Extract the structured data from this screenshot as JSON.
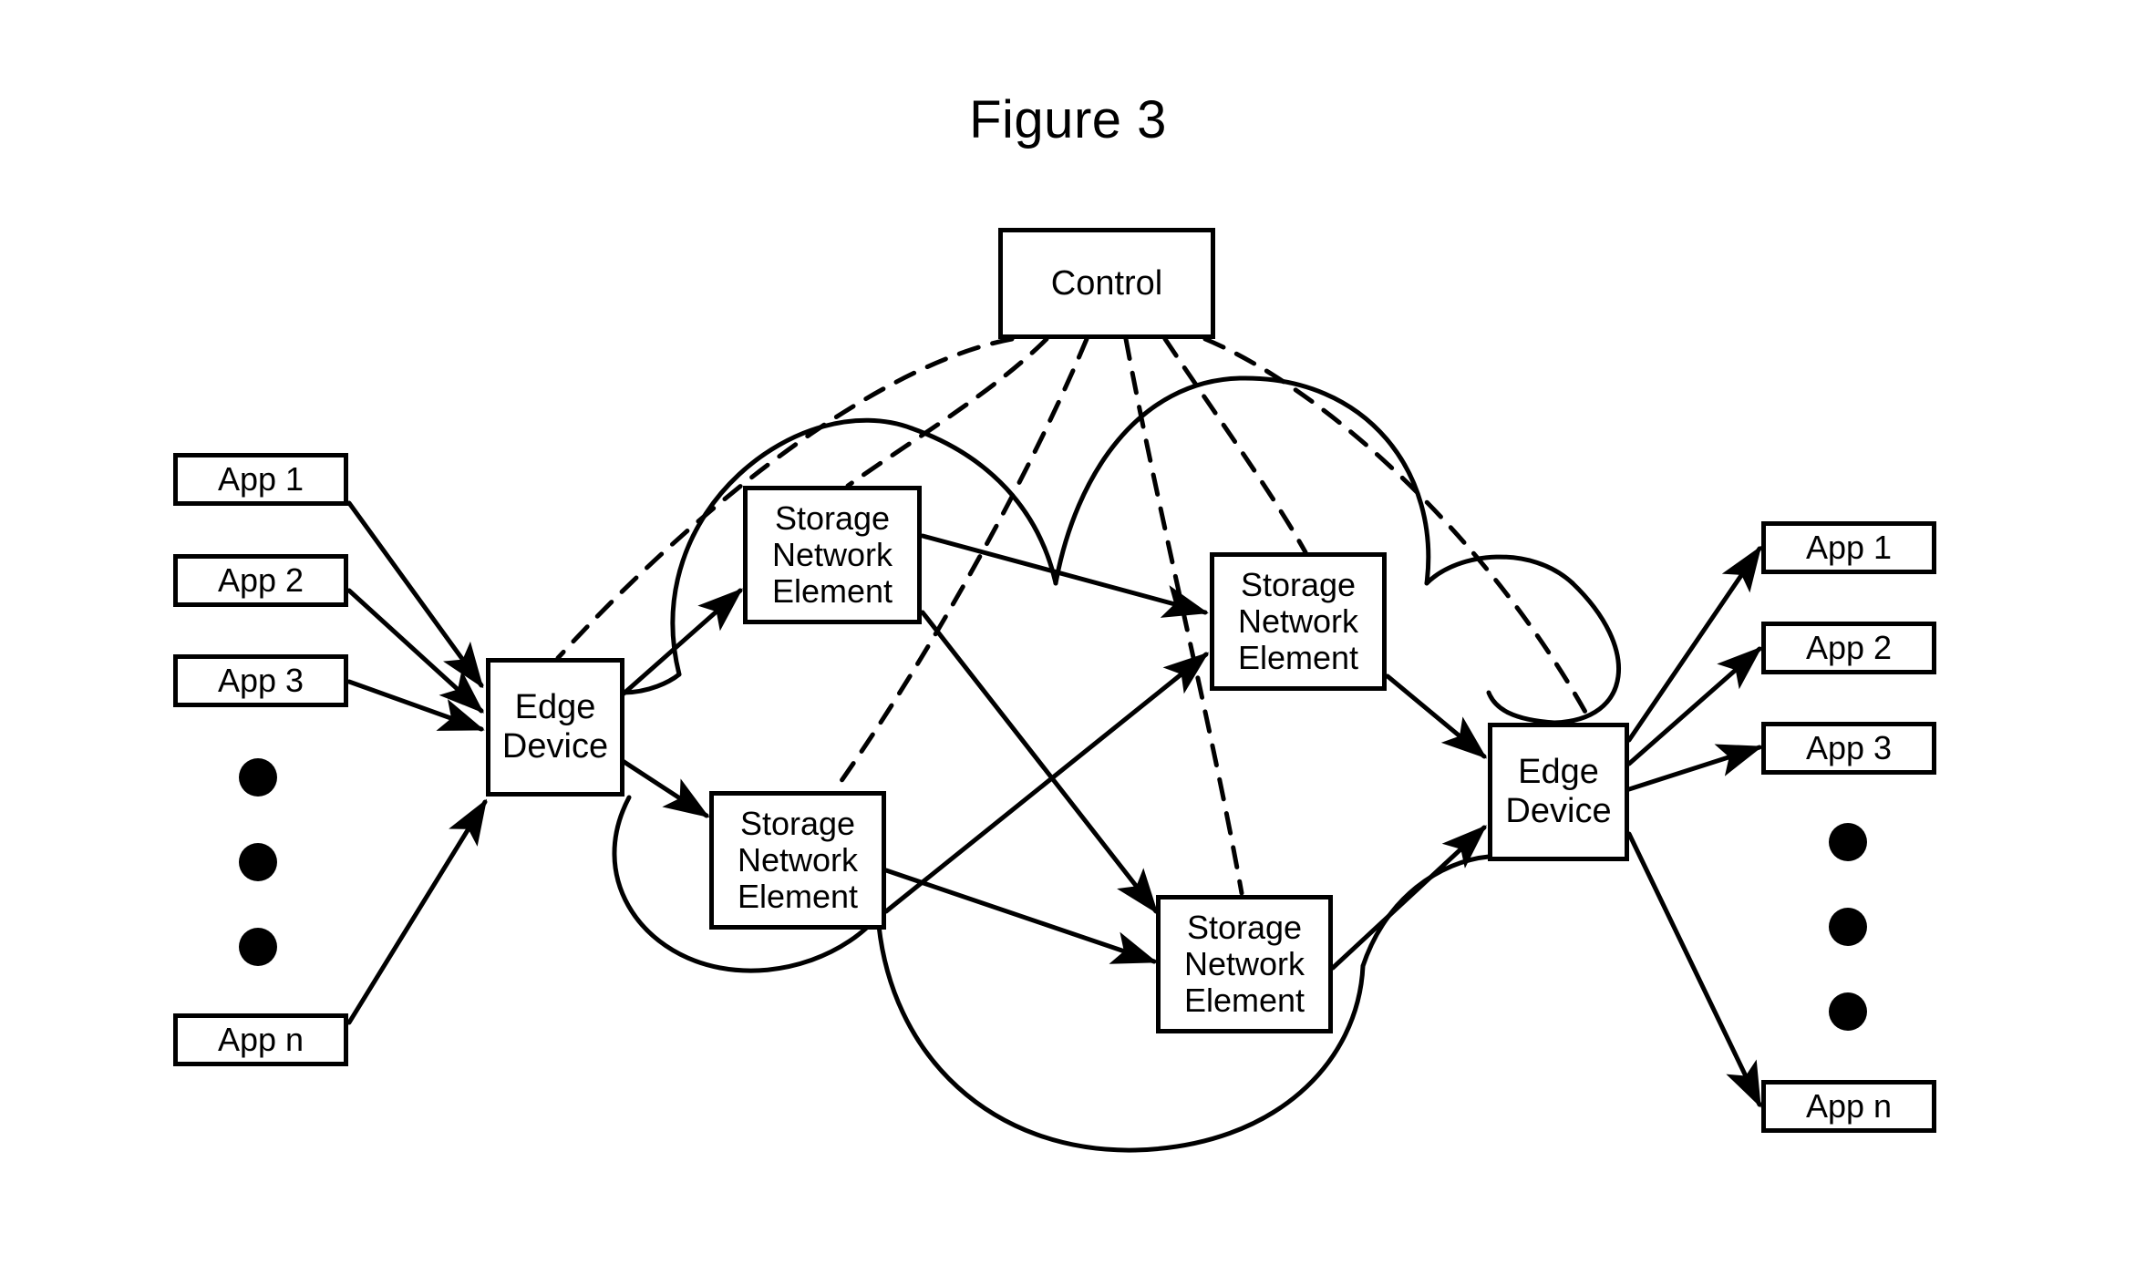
{
  "figure": {
    "title": "Figure 3"
  },
  "control": {
    "label": "Control"
  },
  "edge_devices": [
    {
      "id": "edge-left",
      "label": "Edge Device",
      "line1": "Edge",
      "line2": "Device"
    },
    {
      "id": "edge-right",
      "label": "Edge Device",
      "line1": "Edge",
      "line2": "Device"
    }
  ],
  "storage_network_elements": [
    {
      "id": "sne-1",
      "line1": "Storage",
      "line2": "Network",
      "line3": "Element"
    },
    {
      "id": "sne-2",
      "line1": "Storage",
      "line2": "Network",
      "line3": "Element"
    },
    {
      "id": "sne-3",
      "line1": "Storage",
      "line2": "Network",
      "line3": "Element"
    },
    {
      "id": "sne-4",
      "line1": "Storage",
      "line2": "Network",
      "line3": "Element"
    }
  ],
  "left_apps": [
    {
      "id": "left-app-1",
      "label": "App 1"
    },
    {
      "id": "left-app-2",
      "label": "App 2"
    },
    {
      "id": "left-app-3",
      "label": "App 3"
    },
    {
      "id": "left-app-n",
      "label": "App n"
    }
  ],
  "right_apps": [
    {
      "id": "right-app-1",
      "label": "App 1"
    },
    {
      "id": "right-app-2",
      "label": "App 2"
    },
    {
      "id": "right-app-3",
      "label": "App 3"
    },
    {
      "id": "right-app-n",
      "label": "App n"
    }
  ],
  "ellipsis": {
    "left_count": 3,
    "right_count": 3
  },
  "style": {
    "stroke": "#000000",
    "background": "#ffffff",
    "line_width": 5
  },
  "legend_note": {
    "solid_lines": "data path arrows",
    "dashed_lines": "control plane links from Control",
    "cloud": "storage network cloud boundary"
  }
}
